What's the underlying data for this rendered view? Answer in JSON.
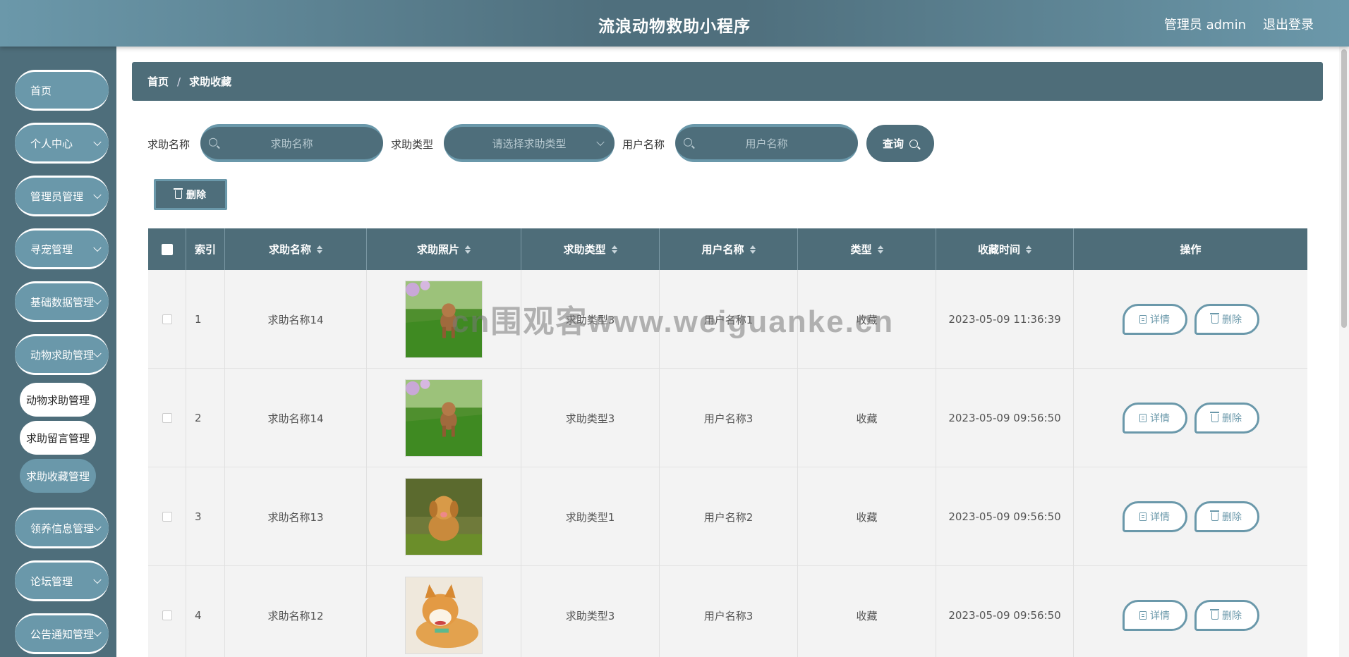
{
  "header": {
    "title": "流浪动物救助小程序",
    "user_label": "管理员 admin",
    "logout_label": "退出登录"
  },
  "sidebar": {
    "items": [
      {
        "label": "首页",
        "has_chevron": false
      },
      {
        "label": "个人中心",
        "has_chevron": true
      },
      {
        "label": "管理员管理",
        "has_chevron": true
      },
      {
        "label": "寻宠管理",
        "has_chevron": true
      },
      {
        "label": "基础数据管理",
        "has_chevron": true
      },
      {
        "label": "动物求助管理",
        "has_chevron": true
      },
      {
        "label": "领养信息管理",
        "has_chevron": true
      },
      {
        "label": "论坛管理",
        "has_chevron": true
      },
      {
        "label": "公告通知管理",
        "has_chevron": true
      }
    ],
    "sub_items": [
      {
        "label": "动物求助管理"
      },
      {
        "label": "求助留言管理"
      },
      {
        "label": "求助收藏管理",
        "active": true
      }
    ]
  },
  "breadcrumb": {
    "home": "首页",
    "separator": "/",
    "current": "求助收藏"
  },
  "search": {
    "name_label": "求助名称",
    "name_placeholder": "求助名称",
    "type_label": "求助类型",
    "type_placeholder": "请选择求助类型",
    "user_label": "用户名称",
    "user_placeholder": "用户名称",
    "query_label": "查询"
  },
  "toolbar": {
    "delete_label": "删除"
  },
  "table": {
    "columns": [
      "索引",
      "求助名称",
      "求助照片",
      "求助类型",
      "用户名称",
      "类型",
      "收藏时间",
      "操作"
    ],
    "rows": [
      {
        "index": "1",
        "name": "求助名称14",
        "photo": "poodle on grass",
        "type": "求助类型3",
        "user": "用户名称1",
        "kind": "收藏",
        "time": "2023-05-09 11:36:39"
      },
      {
        "index": "2",
        "name": "求助名称14",
        "photo": "poodle on grass",
        "type": "求助类型3",
        "user": "用户名称3",
        "kind": "收藏",
        "time": "2023-05-09 09:56:50"
      },
      {
        "index": "3",
        "name": "求助名称13",
        "photo": "golden retriever",
        "type": "求助类型1",
        "user": "用户名称2",
        "kind": "收藏",
        "time": "2023-05-09 09:56:50"
      },
      {
        "index": "4",
        "name": "求助名称12",
        "photo": "shiba inu",
        "type": "求助类型3",
        "user": "用户名称3",
        "kind": "收藏",
        "time": "2023-05-09 09:56:50"
      }
    ],
    "detail_label": "详情",
    "delete_label": "删除"
  },
  "watermark": "cn围观客www.weiguanke.cn",
  "colors": {
    "primary_dark": "#4e6e7b",
    "primary_light": "#6a98aa"
  }
}
